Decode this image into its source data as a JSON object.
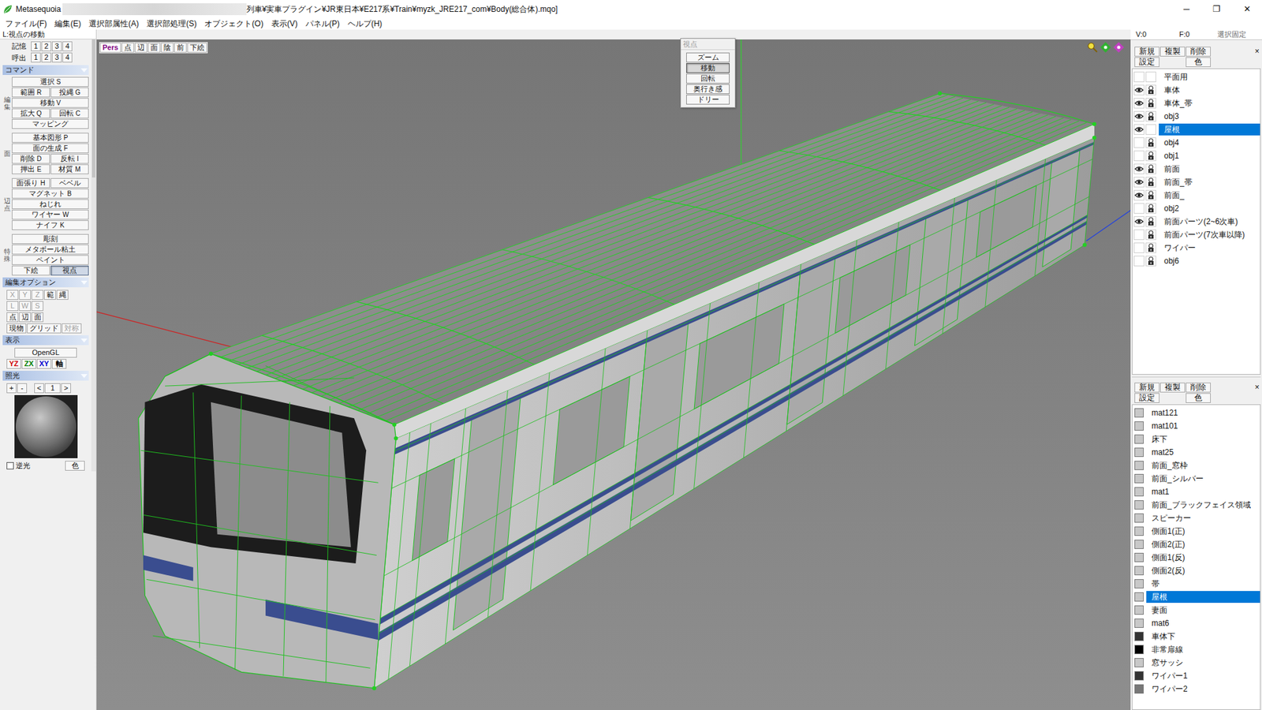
{
  "window": {
    "app_name": "Metasequoia",
    "title": "列車¥実車プラグイン¥JR東日本¥E217系¥Train¥myzk_JRE217_com¥Body(総合体).mqo]",
    "controls": [
      "─",
      "❐",
      "✕"
    ]
  },
  "menu": [
    "ファイル(F)",
    "編集(E)",
    "選択部属性(A)",
    "選択部処理(S)",
    "オブジェクト(O)",
    "表示(V)",
    "パネル(P)",
    "ヘルプ(H)"
  ],
  "status": "L:視点の移動",
  "memory": [
    {
      "label": "記憶",
      "slots": [
        "1",
        "2",
        "3",
        "4"
      ]
    },
    {
      "label": "呼出",
      "slots": [
        "1",
        "2",
        "3",
        "4"
      ]
    }
  ],
  "commands": {
    "title": "コマンド",
    "groups": [
      {
        "label": "編集",
        "rows": [
          [
            {
              "label": "選択",
              "key": "S",
              "selected": false
            }
          ],
          [
            {
              "label": "範囲",
              "key": "R",
              "selected": false
            },
            {
              "label": "投縄",
              "key": "G",
              "selected": false
            }
          ],
          [
            {
              "label": "移動",
              "key": "V",
              "selected": false
            }
          ],
          [
            {
              "label": "拡大",
              "key": "Q",
              "selected": false
            },
            {
              "label": "回転",
              "key": "C",
              "selected": false
            }
          ],
          [
            {
              "label": "マッピング",
              "selected": false
            }
          ]
        ]
      },
      {
        "label": "面",
        "rows": [
          [
            {
              "label": "基本図形",
              "key": "P",
              "selected": false
            }
          ],
          [
            {
              "label": "面の生成",
              "key": "F",
              "selected": false
            }
          ],
          [
            {
              "label": "削除",
              "key": "D",
              "selected": false
            },
            {
              "label": "反転",
              "key": "I",
              "selected": false
            }
          ],
          [
            {
              "label": "押出",
              "key": "E",
              "selected": false
            },
            {
              "label": "材質",
              "key": "M",
              "selected": false
            }
          ]
        ]
      },
      {
        "label": "辺・点",
        "rows": [
          [
            {
              "label": "面張り",
              "key": "H",
              "selected": false
            },
            {
              "label": "ベベル",
              "selected": false
            }
          ],
          [
            {
              "label": "マグネット",
              "key": "B",
              "selected": false
            }
          ],
          [
            {
              "label": "ねじれ",
              "selected": false
            }
          ],
          [
            {
              "label": "ワイヤー",
              "key": "W",
              "selected": false
            }
          ],
          [
            {
              "label": "ナイフ",
              "key": "K",
              "selected": false
            }
          ]
        ]
      },
      {
        "label": "特殊",
        "rows": [
          [
            {
              "label": "彫刻",
              "selected": false
            }
          ],
          [
            {
              "label": "メタボール粘土",
              "selected": false
            }
          ],
          [
            {
              "label": "ペイント",
              "selected": false
            }
          ],
          [
            {
              "label": "下絵",
              "selected": false
            },
            {
              "label": "視点",
              "selected": true
            }
          ]
        ]
      }
    ]
  },
  "edit_options": {
    "title": "編集オプション",
    "rows": [
      [
        {
          "label": "X",
          "disabled": true
        },
        {
          "label": "Y",
          "disabled": true
        },
        {
          "label": "Z",
          "disabled": true
        },
        {
          "label": "範",
          "disabled": false
        },
        {
          "label": "縄",
          "disabled": false
        }
      ],
      [
        {
          "label": "L",
          "disabled": true
        },
        {
          "label": "W",
          "disabled": true
        },
        {
          "label": "S",
          "disabled": true
        }
      ],
      [
        {
          "label": "点",
          "disabled": false
        },
        {
          "label": "辺",
          "disabled": false
        },
        {
          "label": "面",
          "disabled": false
        }
      ],
      [
        {
          "label": "現物",
          "disabled": false
        },
        {
          "label": "グリッド",
          "disabled": false
        },
        {
          "label": "対称",
          "disabled": true
        }
      ]
    ]
  },
  "display": {
    "title": "表示",
    "renderer": "OpenGL",
    "planes": [
      {
        "label": "YZ",
        "color": "#d00000"
      },
      {
        "label": "ZX",
        "color": "#008000"
      },
      {
        "label": "XY",
        "color": "#0000d0"
      },
      {
        "label": "軸",
        "color": "#000000"
      }
    ]
  },
  "lighting": {
    "title": "照光",
    "buttons": [
      "+",
      "-",
      "<",
      "1",
      ">"
    ],
    "backlight": {
      "label": "逆光",
      "checked": false
    },
    "color_button": "色"
  },
  "viewport": {
    "toolbar": [
      {
        "label": "Pers",
        "selected": true
      },
      {
        "label": "点",
        "selected": false
      },
      {
        "label": "辺",
        "selected": false
      },
      {
        "label": "面",
        "selected": false
      },
      {
        "label": "陰",
        "selected": false
      },
      {
        "label": "前",
        "selected": false
      },
      {
        "label": "下絵",
        "selected": false
      }
    ]
  },
  "view_popup": {
    "title": "視点",
    "buttons": [
      {
        "label": "ズーム",
        "selected": false
      },
      {
        "label": "移動",
        "selected": true
      },
      {
        "label": "回転",
        "selected": false
      },
      {
        "label": "奥行き感",
        "selected": false
      },
      {
        "label": "ドリー",
        "selected": false
      }
    ]
  },
  "info_bar": {
    "counters": [
      "V:0",
      "F:0"
    ],
    "lock_selection": "選択固定"
  },
  "objects_panel": {
    "buttons": [
      "新規",
      "複製",
      "削除"
    ],
    "buttons2": [
      "設定",
      "色"
    ],
    "close": "×",
    "items": [
      {
        "name": "平面用",
        "visible": false,
        "locked": false,
        "selected": false
      },
      {
        "name": "車体",
        "visible": true,
        "locked": true,
        "selected": false
      },
      {
        "name": "車体_帯",
        "visible": true,
        "locked": true,
        "selected": false
      },
      {
        "name": "obj3",
        "visible": true,
        "locked": true,
        "selected": false
      },
      {
        "name": "屋根",
        "visible": true,
        "locked": false,
        "selected": true
      },
      {
        "name": "obj4",
        "visible": false,
        "locked": true,
        "selected": false
      },
      {
        "name": "obj1",
        "visible": false,
        "locked": true,
        "selected": false
      },
      {
        "name": "前面",
        "visible": true,
        "locked": true,
        "selected": false
      },
      {
        "name": "前面_帯",
        "visible": true,
        "locked": true,
        "selected": false
      },
      {
        "name": "前面_",
        "visible": true,
        "locked": true,
        "selected": false
      },
      {
        "name": "obj2",
        "visible": false,
        "locked": true,
        "selected": false
      },
      {
        "name": "前面パーツ(2~6次車)",
        "visible": true,
        "locked": true,
        "selected": false
      },
      {
        "name": "前面パーツ(7次車以降)",
        "visible": false,
        "locked": true,
        "selected": false
      },
      {
        "name": "ワイパー",
        "visible": false,
        "locked": true,
        "selected": false
      },
      {
        "name": "obj6",
        "visible": false,
        "locked": true,
        "selected": false
      }
    ]
  },
  "materials_panel": {
    "buttons": [
      "新規",
      "複製",
      "削除"
    ],
    "buttons2": [
      "設定",
      "色"
    ],
    "close": "×",
    "items": [
      {
        "name": "mat121",
        "color": "#c8c8c8",
        "selected": false
      },
      {
        "name": "mat101",
        "color": "#c8c8c8",
        "selected": false
      },
      {
        "name": "床下",
        "color": "#c8c8c8",
        "selected": false
      },
      {
        "name": "mat25",
        "color": "#c8c8c8",
        "selected": false
      },
      {
        "name": "前面_窓枠",
        "color": "#c8c8c8",
        "selected": false
      },
      {
        "name": "前面_シルバー",
        "color": "#c8c8c8",
        "selected": false
      },
      {
        "name": "mat1",
        "color": "#c8c8c8",
        "selected": false
      },
      {
        "name": "前面_ブラックフェイス領域",
        "color": "#c8c8c8",
        "selected": false
      },
      {
        "name": "スピーカー",
        "color": "#c8c8c8",
        "selected": false
      },
      {
        "name": "側面1(正)",
        "color": "#c8c8c8",
        "selected": false
      },
      {
        "name": "側面2(正)",
        "color": "#c8c8c8",
        "selected": false
      },
      {
        "name": "側面1(反)",
        "color": "#c8c8c8",
        "selected": false
      },
      {
        "name": "側面2(反)",
        "color": "#c8c8c8",
        "selected": false
      },
      {
        "name": "帯",
        "color": "#c8c8c8",
        "selected": false
      },
      {
        "name": "屋根",
        "color": "#c8c8c8",
        "selected": true
      },
      {
        "name": "妻面",
        "color": "#c8c8c8",
        "selected": false
      },
      {
        "name": "mat6",
        "color": "#c8c8c8",
        "selected": false
      },
      {
        "name": "車体下",
        "color": "#333333",
        "selected": false
      },
      {
        "name": "非常扉線",
        "color": "#000000",
        "selected": false
      },
      {
        "name": "窓サッシ",
        "color": "#c8c8c8",
        "selected": false
      },
      {
        "name": "ワイパー1",
        "color": "#333333",
        "selected": false
      },
      {
        "name": "ワイパー2",
        "color": "#777777",
        "selected": false
      }
    ]
  }
}
